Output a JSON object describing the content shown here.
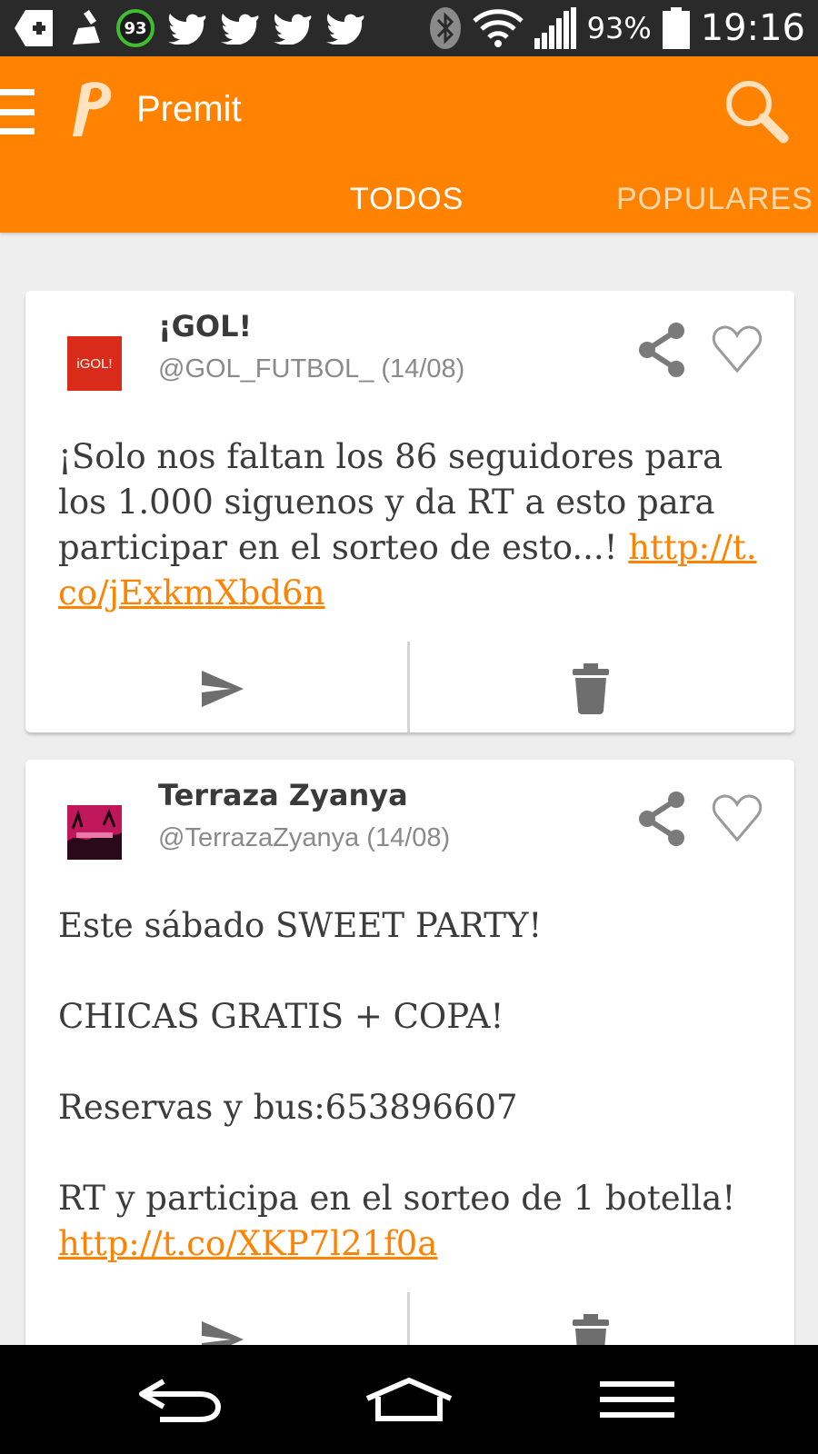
{
  "status_bar": {
    "battery_badge": "93",
    "battery_percent": "93%",
    "time": "19:16"
  },
  "app_bar": {
    "title": "Premit"
  },
  "tabs": [
    {
      "label": "TODOS",
      "active": true
    },
    {
      "label": "POPULARES",
      "active": false
    }
  ],
  "posts": [
    {
      "avatar_text": "iGOL!",
      "name": "¡GOL!",
      "handle": "@GOL_FUTBOL_ (14/08)",
      "text": "¡Solo nos faltan los 86 seguidores para los 1.000 siguenos y da RT a esto para participar en el sorteo de esto...! ",
      "link": "http://t.co/jExkmXbd6n"
    },
    {
      "avatar_text": "",
      "name": "Terraza Zyanya",
      "handle": "@TerrazaZyanya (14/08)",
      "text": "Este sábado SWEET PARTY!\n\nCHICAS GRATIS + COPA!\n\nReservas y bus:653896607\n\nRT y participa en el sorteo de 1 botella!\n",
      "link": "http://t.co/XKP7l21f0a"
    }
  ],
  "colors": {
    "accent": "#ff8300",
    "status_bar": "#2a2a2a",
    "background": "#eeeeee"
  }
}
